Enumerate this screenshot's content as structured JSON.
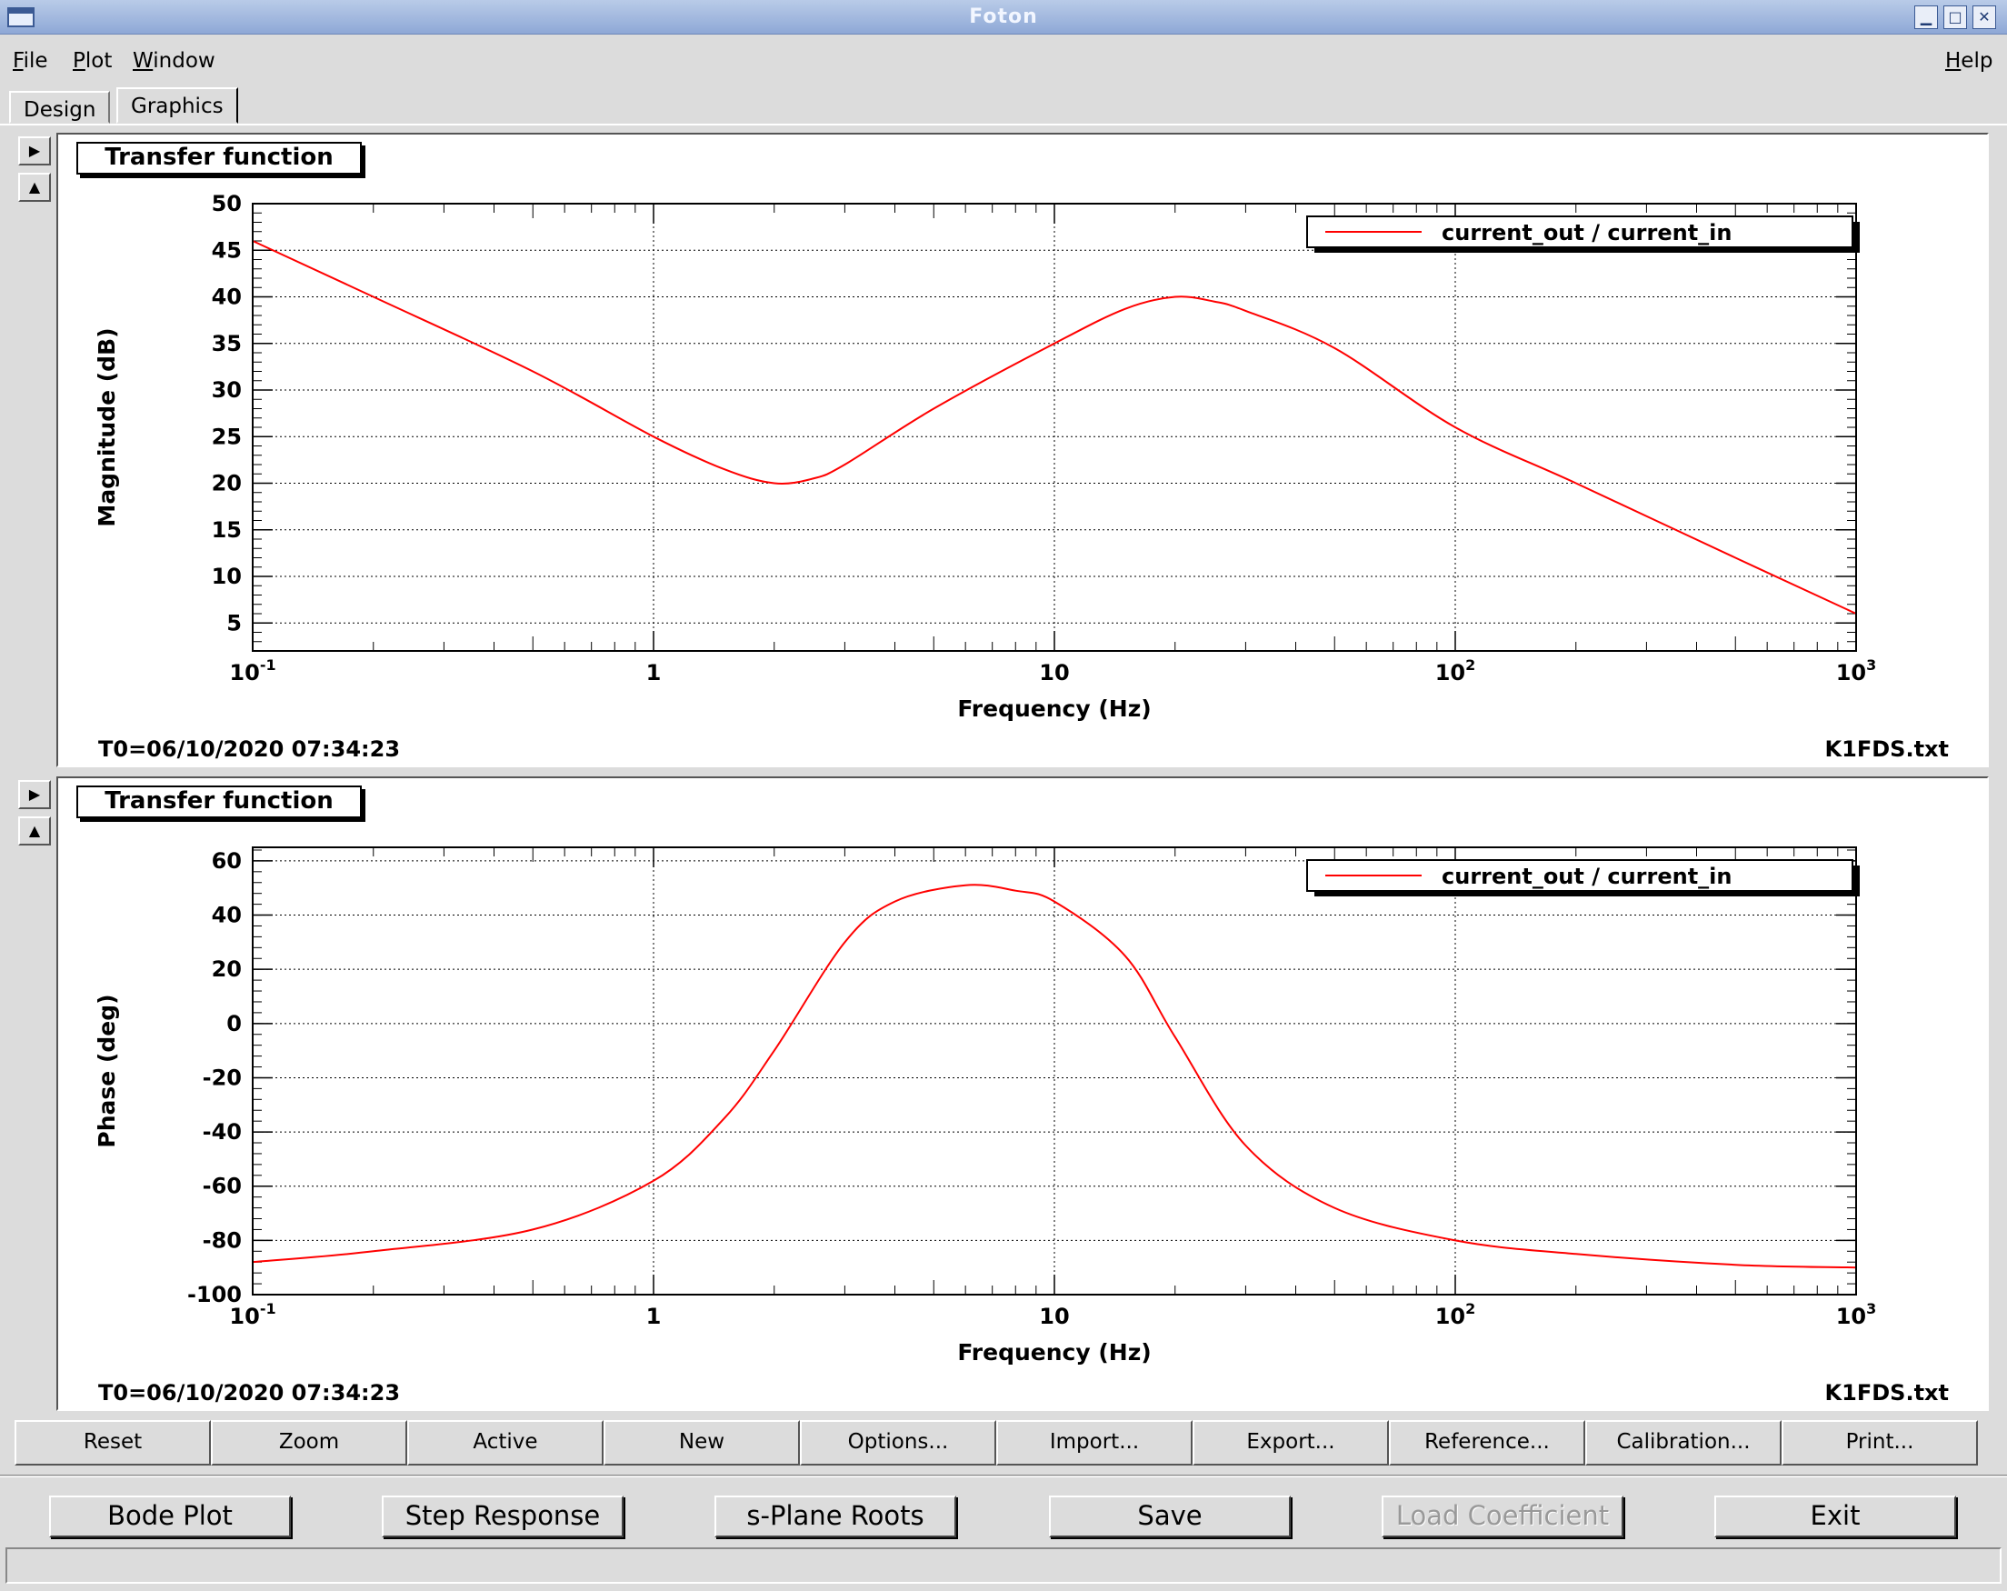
{
  "window": {
    "title": "Foton"
  },
  "menubar": {
    "file": {
      "u": "F",
      "rest": "ile"
    },
    "plot": {
      "u": "P",
      "rest": "lot"
    },
    "window": {
      "u": "W",
      "rest": "indow"
    },
    "help": {
      "u": "H",
      "rest": "elp"
    }
  },
  "tabs": [
    {
      "label": "Design"
    },
    {
      "label": "Graphics"
    }
  ],
  "plots": [
    {
      "panel_title": "Transfer function",
      "legend": "current_out / current_in",
      "ylabel": "Magnitude (dB)",
      "xlabel": "Frequency (Hz)",
      "t0": "T0=06/10/2020 07:34:23",
      "filename": "K1FDS.txt",
      "x_ticks": [
        {
          "base": "10",
          "exp": "-1"
        },
        {
          "base": "1",
          "exp": ""
        },
        {
          "base": "10",
          "exp": ""
        },
        {
          "base": "10",
          "exp": "2"
        },
        {
          "base": "10",
          "exp": "3"
        }
      ],
      "y_ticks": [
        "5",
        "10",
        "15",
        "20",
        "25",
        "30",
        "35",
        "40",
        "45",
        "50"
      ]
    },
    {
      "panel_title": "Transfer function",
      "legend": "current_out / current_in",
      "ylabel": "Phase (deg)",
      "xlabel": "Frequency (Hz)",
      "t0": "T0=06/10/2020 07:34:23",
      "filename": "K1FDS.txt",
      "x_ticks": [
        {
          "base": "10",
          "exp": "-1"
        },
        {
          "base": "1",
          "exp": ""
        },
        {
          "base": "10",
          "exp": ""
        },
        {
          "base": "10",
          "exp": "2"
        },
        {
          "base": "10",
          "exp": "3"
        }
      ],
      "y_ticks": [
        "-100",
        "-80",
        "-60",
        "-40",
        "-20",
        "0",
        "20",
        "40",
        "60"
      ]
    }
  ],
  "chart_data": [
    {
      "type": "line",
      "xscale": "log",
      "xlim": [
        0.1,
        1000
      ],
      "ylim": [
        2,
        50
      ],
      "grid": true,
      "legend_position": "top-right",
      "color": "#ff0000",
      "series": [
        {
          "name": "current_out / current_in",
          "x": [
            0.1,
            0.2,
            0.5,
            1,
            1.5,
            2,
            2.5,
            3,
            5,
            10,
            15,
            20,
            25,
            30,
            50,
            100,
            200,
            500,
            1000
          ],
          "y": [
            46,
            40,
            32,
            25,
            21.5,
            20,
            20.5,
            22,
            28,
            35,
            38.7,
            40,
            39.5,
            38.5,
            34.5,
            26,
            20,
            12,
            6
          ]
        }
      ]
    },
    {
      "type": "line",
      "xscale": "log",
      "xlim": [
        0.1,
        1000
      ],
      "ylim": [
        -100,
        65
      ],
      "grid": true,
      "legend_position": "top-right",
      "color": "#ff0000",
      "series": [
        {
          "name": "current_out / current_in",
          "x": [
            0.1,
            0.2,
            0.5,
            1,
            1.5,
            2,
            3,
            4,
            6,
            8,
            10,
            15,
            20,
            30,
            50,
            100,
            200,
            500,
            1000
          ],
          "y": [
            -88,
            -84,
            -76,
            -58,
            -35,
            -10,
            30,
            45,
            51,
            49,
            45,
            25,
            -5,
            -45,
            -68,
            -80,
            -85,
            -89,
            -90
          ]
        }
      ]
    }
  ],
  "controls": [
    {
      "label": "Reset"
    },
    {
      "label": "Zoom"
    },
    {
      "label": "Active"
    },
    {
      "label": "New"
    },
    {
      "label": "Options..."
    },
    {
      "label": "Import..."
    },
    {
      "label": "Export..."
    },
    {
      "label": "Reference..."
    },
    {
      "label": "Calibration..."
    },
    {
      "label": "Print..."
    }
  ],
  "actions": [
    {
      "label": "Bode Plot"
    },
    {
      "label": "Step Response"
    },
    {
      "label": "s-Plane Roots"
    },
    {
      "label": "Save"
    },
    {
      "label": "Load Coefficient"
    },
    {
      "label": "Exit"
    }
  ]
}
